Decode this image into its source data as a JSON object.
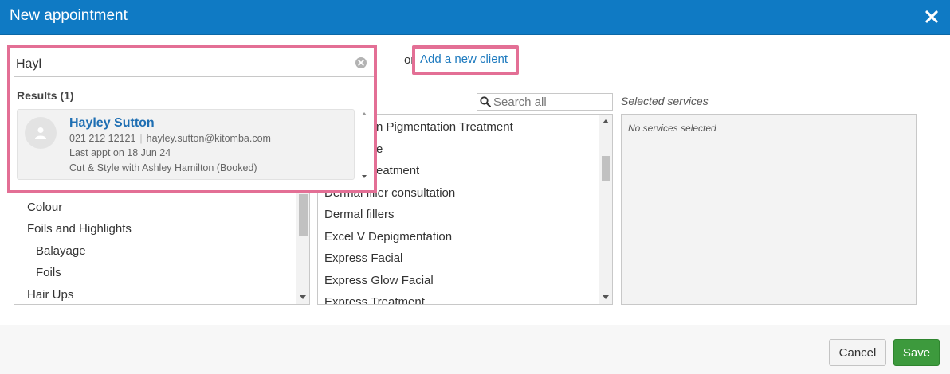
{
  "dialog": {
    "title": "New appointment"
  },
  "client_search": {
    "value": "Hayl",
    "results_heading": "Results (1)",
    "results": [
      {
        "name": "Hayley Sutton",
        "phone": "021 212 12121",
        "email": "hayley.sutton@kitomba.com",
        "last_appt": "Last appt on 18 Jun 24",
        "service_line": "Cut & Style with Ashley Hamilton (Booked)"
      }
    ]
  },
  "or_text": "or",
  "add_client_label": "Add a new client",
  "search_all": {
    "placeholder": "Search all"
  },
  "selected_services": {
    "label": "Selected services",
    "empty": "No services selected"
  },
  "categories": [
    "Colour",
    "Foils and Highlights",
    "Balayage",
    "Foils",
    "Hair Ups"
  ],
  "services": [
    "n Pigmentation Treatment",
    "e",
    "eatment",
    "Dermal filler consultation",
    "Dermal fillers",
    "Excel V Depigmentation",
    "Express Facial",
    "Express Glow Facial",
    "Express Treatment"
  ],
  "footer": {
    "cancel": "Cancel",
    "save": "Save"
  },
  "colors": {
    "header": "#0f7ac4",
    "highlight": "#e36f95",
    "save": "#3d9a3d",
    "link": "#1f7bbf"
  },
  "icons": {
    "close": "close-icon",
    "clear": "clear-search-icon",
    "search": "search-icon",
    "avatar": "user-icon"
  }
}
